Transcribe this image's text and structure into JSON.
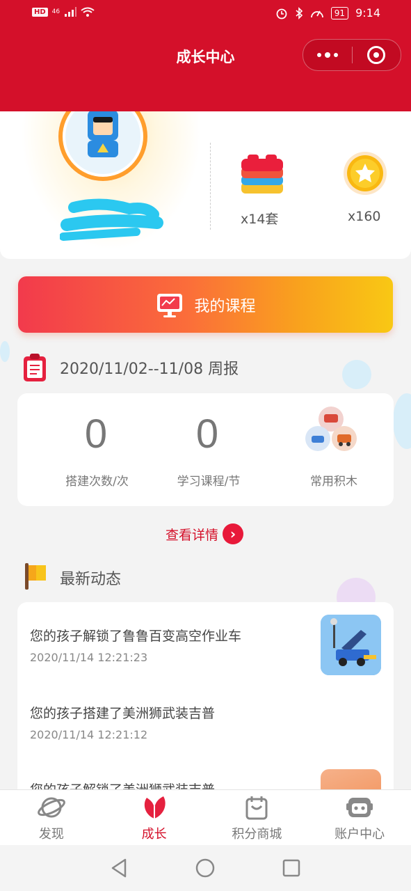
{
  "status_bar": {
    "network": "HD",
    "signal": "46",
    "battery": "91",
    "time": "9:14"
  },
  "header": {
    "title": "成长中心"
  },
  "profile": {
    "bricks": "x14套",
    "stars": "x160"
  },
  "courses_button": "我的课程",
  "weekly": {
    "title": "2020/11/02--11/08 周报",
    "build_count": "0",
    "build_label": "搭建次数/次",
    "course_count": "0",
    "course_label": "学习课程/节",
    "blocks_label": "常用积木",
    "details_link": "查看详情"
  },
  "news": {
    "title": "最新动态",
    "items": [
      {
        "text": "您的孩子解锁了鲁鲁百变高空作业车",
        "time": "2020/11/14 12:21:23"
      },
      {
        "text": "您的孩子搭建了美洲狮武装吉普",
        "time": "2020/11/14 12:21:12"
      },
      {
        "text": "您的孩子解锁了美洲狮武装吉普"
      }
    ]
  },
  "tabs": [
    {
      "label": "发现",
      "icon": "planet-icon"
    },
    {
      "label": "成长",
      "icon": "leaf-icon"
    },
    {
      "label": "积分商城",
      "icon": "shopping-bag-icon"
    },
    {
      "label": "账户中心",
      "icon": "robot-face-icon"
    }
  ],
  "colors": {
    "brand_red": "#d4102a",
    "gradient_start": "#f23a4c",
    "gradient_end": "#f9c814"
  }
}
